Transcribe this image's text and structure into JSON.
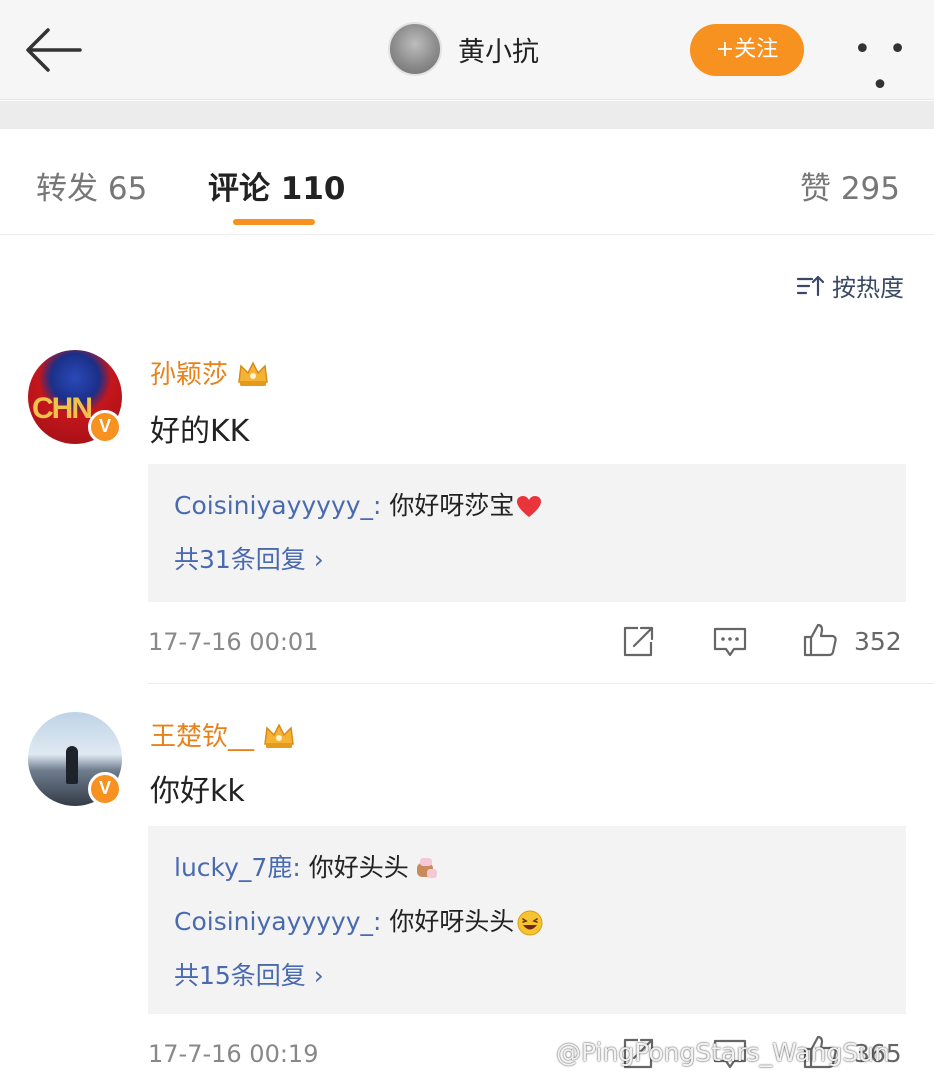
{
  "header": {
    "back_icon": "back-arrow-icon",
    "user_name": "黄小抗",
    "follow_label": "+关注",
    "more_label": "• • •",
    "accent_color": "#f7911f"
  },
  "tabs": {
    "repost": "转发 65",
    "comments": "评论 110",
    "likes": "赞 295"
  },
  "sort_label": "按热度",
  "comments": [
    {
      "user": "孙颖莎",
      "avatar_text": "CHN",
      "badge": "V",
      "text": "好的KK",
      "replies": [
        {
          "user": "Coisiniyayyyyy_:",
          "text": " 你好呀莎宝",
          "emoji": "heart"
        }
      ],
      "more_replies": "共31条回复 ›",
      "time": "17-7-16 00:01",
      "likes": "352"
    },
    {
      "user": "王楚钦__",
      "badge": "V",
      "text": "你好kk",
      "replies": [
        {
          "user": "lucky_7鹿:",
          "text": " 你好头头",
          "emoji": "fist"
        },
        {
          "user": "Coisiniyayyyyy_:",
          "text": " 你好呀头头",
          "emoji": "laugh"
        }
      ],
      "more_replies": "共15条回复 ›",
      "time": "17-7-16 00:19",
      "likes": "365"
    }
  ],
  "watermark": "@PingPongStars_WangSun"
}
